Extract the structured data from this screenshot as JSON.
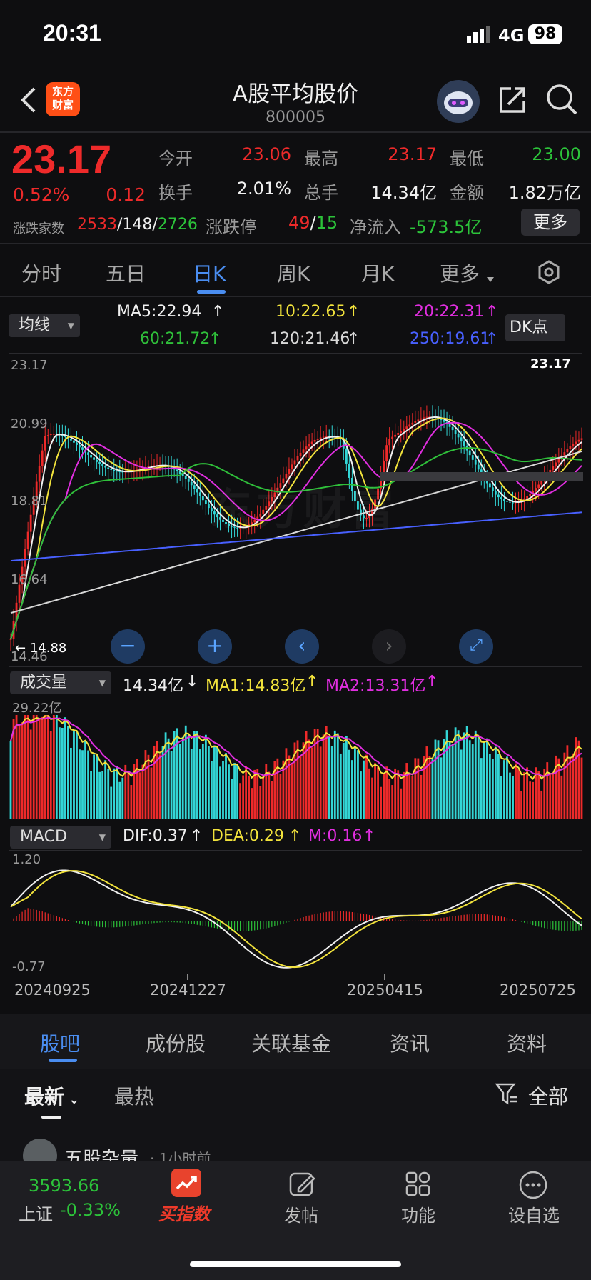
{
  "status": {
    "time": "20:31",
    "network": "4G",
    "battery": "98"
  },
  "header": {
    "logo": "东方\n财富",
    "title": "A股平均股价",
    "code": "800005"
  },
  "quote": {
    "price": "23.17",
    "change_pct": "0.52%",
    "change": "0.12",
    "open_label": "今开",
    "open": "23.06",
    "high_label": "最高",
    "high": "23.17",
    "low_label": "最低",
    "low": "23.00",
    "turnover_label": "换手",
    "turnover": "2.01%",
    "volume_label": "总手",
    "volume": "14.34亿",
    "amount_label": "金额",
    "amount": "1.82万亿",
    "breadth_label": "涨跌家数",
    "up": "2533",
    "flat": "148",
    "down": "2726",
    "limit_label": "涨跌停",
    "limit_up": "49",
    "limit_down": "15",
    "inflow_label": "净流入",
    "inflow": "-573.5亿",
    "more": "更多"
  },
  "tabs": [
    "分时",
    "五日",
    "日K",
    "周K",
    "月K",
    "更多"
  ],
  "ma": {
    "dropdown": "均线",
    "ma5": "MA5:22.94",
    "ma10": "10:22.65",
    "ma20": "20:22.31",
    "ma60": "60:21.72",
    "ma120": "120:21.46",
    "ma250": "250:19.61",
    "dk": "DK点"
  },
  "kline": {
    "y_labels": [
      "23.17",
      "20.99",
      "18.81",
      "16.64",
      "14.46"
    ],
    "last_label": "23.17",
    "low_label": "14.88",
    "watermark": "东方财富"
  },
  "volume": {
    "dropdown": "成交量",
    "value": "14.34亿",
    "ma1": "MA1:14.83亿",
    "ma2": "MA2:13.31亿",
    "top_label": "29.22亿"
  },
  "macd": {
    "dropdown": "MACD",
    "dif": "DIF:0.37",
    "dea": "DEA:0.29",
    "m": "M:0.16",
    "top": "1.20",
    "bottom": "-0.77"
  },
  "dates": [
    "20240925",
    "20241227",
    "20250415",
    "20250725"
  ],
  "bottom_tabs": [
    "股吧",
    "成份股",
    "关联基金",
    "资讯",
    "资料"
  ],
  "feed": {
    "latest": "最新",
    "hot": "最热",
    "filter": "全部",
    "post_user": "五股杂量",
    "post_time": "· 1小时前"
  },
  "nav": {
    "index_value": "3593.66",
    "index_name": "上证",
    "index_change": "-0.33%",
    "buy": "买指数",
    "post": "发帖",
    "func": "功能",
    "watch": "设自选"
  },
  "colors": {
    "up": "#ee2a2a",
    "down": "#2cc33a",
    "accent": "#4a8df0",
    "ma5": "#f0f0f0",
    "ma10": "#f2e33c",
    "ma20": "#e12ee0",
    "ma60": "#2fbf3a",
    "ma120": "#d8d8d8",
    "ma250": "#4860ff"
  }
}
